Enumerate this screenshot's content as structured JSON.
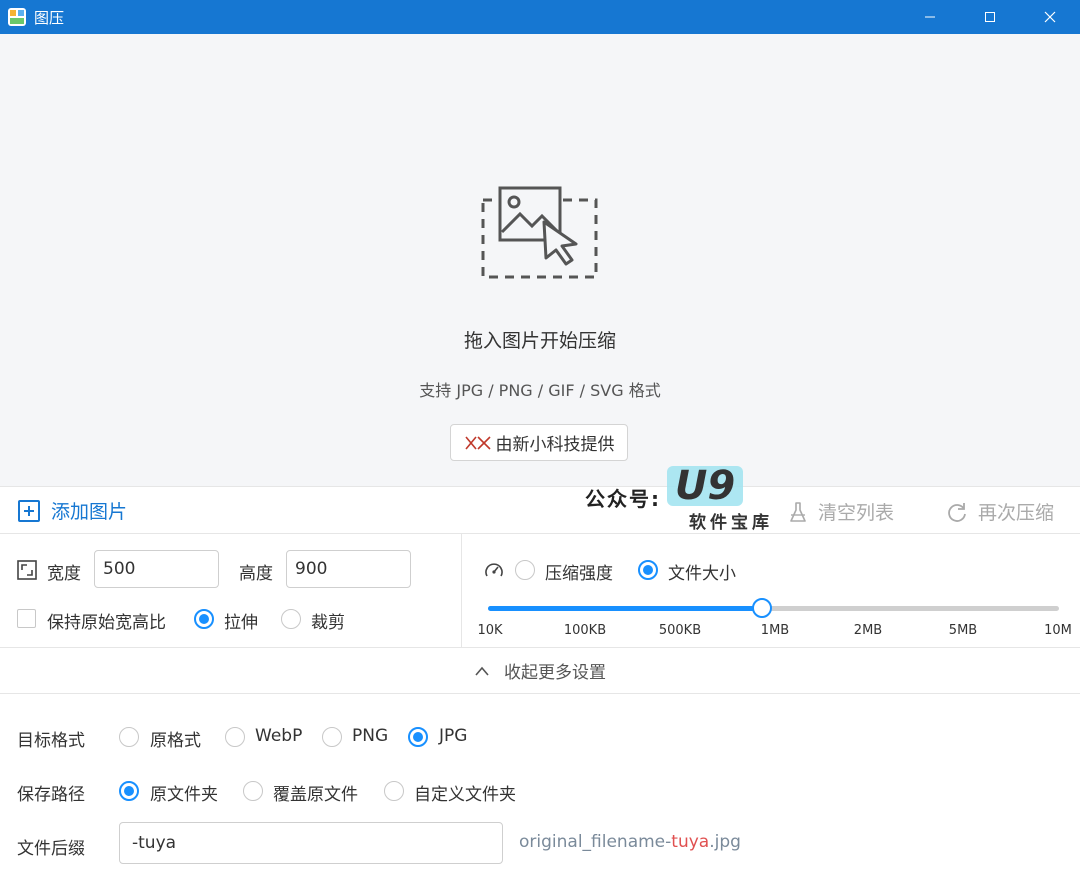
{
  "window": {
    "title": "图压"
  },
  "drop_area": {
    "title": "拖入图片开始压缩",
    "subtitle": "支持 JPG / PNG / GIF / SVG 格式",
    "provider_label": "由新小科技提供",
    "icon": "image-drop-icon"
  },
  "toolbar": {
    "add_label": "添加图片",
    "clear_label": "清空列表",
    "recompress_label": "再次压缩"
  },
  "watermark": {
    "label": "公众号:",
    "logo": "U9",
    "sub": "软件宝库"
  },
  "resize": {
    "width_label": "宽度",
    "width_value": "500",
    "height_label": "高度",
    "height_value": "900",
    "keep_ratio_label": "保持原始宽高比",
    "keep_ratio_checked": false,
    "stretch_label": "拉伸",
    "crop_label": "裁剪",
    "mode_selected": "stretch"
  },
  "compress": {
    "strength_label": "压缩强度",
    "filesize_label": "文件大小",
    "mode_selected": "filesize",
    "slider_ticks": [
      "10K",
      "100KB",
      "500KB",
      "1MB",
      "2MB",
      "5MB",
      "10M"
    ],
    "slider_selected": "1MB"
  },
  "collapse_label": "收起更多设置",
  "target_format": {
    "label": "目标格式",
    "options": [
      "原格式",
      "WebP",
      "PNG",
      "JPG"
    ],
    "selected": "JPG"
  },
  "save_path": {
    "label": "保存路径",
    "options": [
      "原文件夹",
      "覆盖原文件",
      "自定义文件夹"
    ],
    "selected": "原文件夹"
  },
  "suffix": {
    "label": "文件后缀",
    "value": "-tuya",
    "preview_prefix": "original_filename-",
    "preview_highlight": "tuya",
    "preview_ext": ".jpg"
  },
  "colors": {
    "titlebar": "#1677d2",
    "accent": "#1890ff"
  }
}
